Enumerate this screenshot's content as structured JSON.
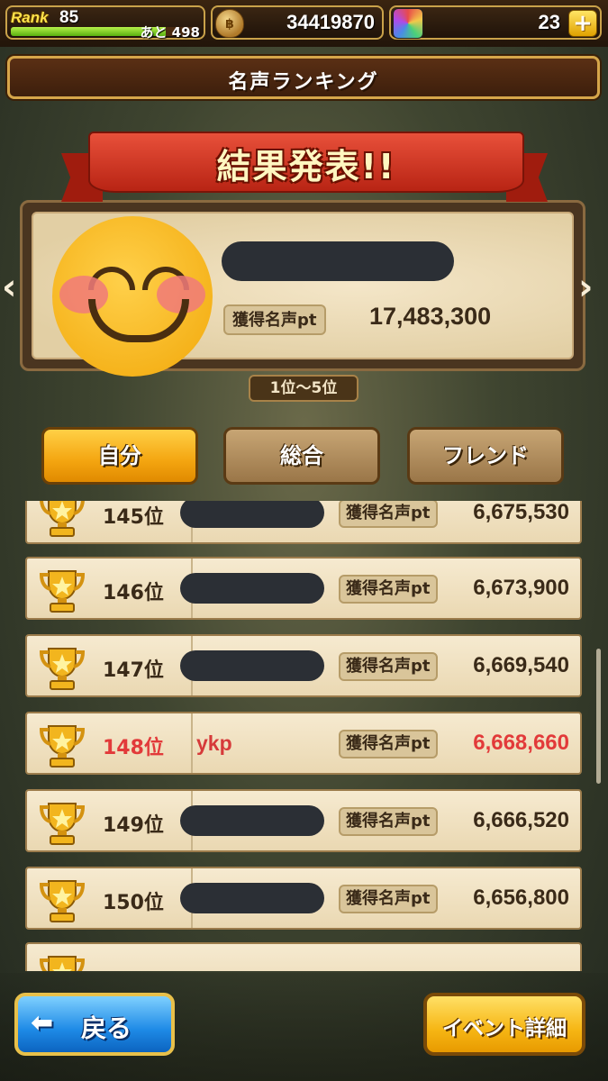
{
  "status_bar": {
    "rank_label": "Rank",
    "rank_value": "85",
    "exp_progress_percent": 82,
    "exp_remaining": "あと 498",
    "coin_symbol": "฿",
    "coins": "34419870",
    "gems": "23",
    "plus_label": "+"
  },
  "title": "名声ランキング",
  "result": {
    "banner": "結果発表!!",
    "fame_label": "獲得名声pt",
    "fame_value": "17,483,300",
    "range_badge": "1位〜5位",
    "nav_left": "‹",
    "nav_right": "›"
  },
  "tabs": [
    {
      "label": "自分",
      "active": true
    },
    {
      "label": "総合",
      "active": false
    },
    {
      "label": "フレンド",
      "active": false
    }
  ],
  "rows": [
    {
      "rank": "145位",
      "name": "",
      "pt_label": "獲得名声pt",
      "pt": "6,675,530",
      "highlight": false
    },
    {
      "rank": "146位",
      "name": "",
      "pt_label": "獲得名声pt",
      "pt": "6,673,900",
      "highlight": false
    },
    {
      "rank": "147位",
      "name": "",
      "pt_label": "獲得名声pt",
      "pt": "6,669,540",
      "highlight": false
    },
    {
      "rank": "148位",
      "name": "ykp",
      "pt_label": "獲得名声pt",
      "pt": "6,668,660",
      "highlight": true
    },
    {
      "rank": "149位",
      "name": "",
      "pt_label": "獲得名声pt",
      "pt": "6,666,520",
      "highlight": false
    },
    {
      "rank": "150位",
      "name": "",
      "pt_label": "獲得名声pt",
      "pt": "6,656,800",
      "highlight": false
    }
  ],
  "buttons": {
    "back_arrow": "⬅",
    "back_label": "戻る",
    "event_label": "イベント詳細"
  },
  "colors": {
    "highlight_text": "#e23a3a",
    "active_tab": "#f4a510",
    "back_button": "#1e8ae6",
    "event_button": "#f6b614"
  },
  "icons": {
    "coin": "coin-bag-icon",
    "gem": "rainbow-gem-icon",
    "trophy": "gold-trophy-icon",
    "back": "left-arrow-icon"
  }
}
